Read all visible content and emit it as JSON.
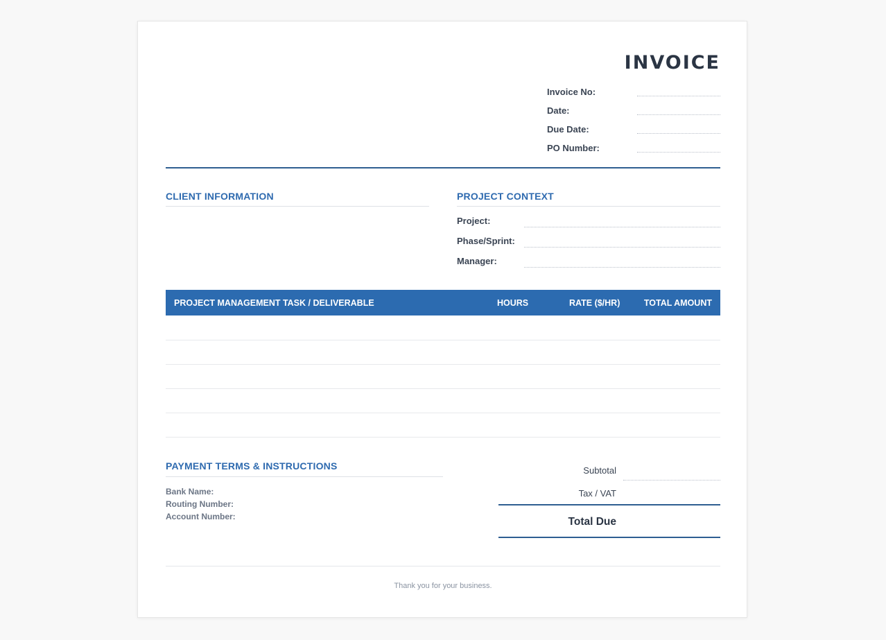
{
  "invoice": {
    "title": "INVOICE",
    "meta": [
      {
        "label": "Invoice No:",
        "value": ""
      },
      {
        "label": "Date:",
        "value": ""
      },
      {
        "label": "Due Date:",
        "value": ""
      },
      {
        "label": "PO Number:",
        "value": ""
      }
    ]
  },
  "client": {
    "heading": "CLIENT INFORMATION"
  },
  "project": {
    "heading": "PROJECT CONTEXT",
    "fields": [
      {
        "label": "Project:",
        "value": ""
      },
      {
        "label": "Phase/Sprint:",
        "value": ""
      },
      {
        "label": "Manager:",
        "value": ""
      }
    ]
  },
  "table": {
    "headers": [
      "PROJECT MANAGEMENT TASK / DELIVERABLE",
      "HOURS",
      "RATE ($/HR)",
      "TOTAL AMOUNT"
    ],
    "rows": [
      [
        "",
        "",
        "",
        ""
      ],
      [
        "",
        "",
        "",
        ""
      ],
      [
        "",
        "",
        "",
        ""
      ],
      [
        "",
        "",
        "",
        ""
      ],
      [
        "",
        "",
        "",
        ""
      ]
    ]
  },
  "payment": {
    "heading": "PAYMENT TERMS & INSTRUCTIONS",
    "fields": [
      "Bank Name:",
      "Routing Number:",
      "Account Number:"
    ]
  },
  "totals": {
    "subtotal_label": "Subtotal",
    "tax_label": "Tax / VAT",
    "total_due_label": "Total Due"
  },
  "footer": {
    "thanks": "Thank you for your business."
  },
  "colors": {
    "accent": "#2c6bb0",
    "rule": "#2e5e91",
    "heading_text": "#2e6aaf",
    "body_text": "#3a4453",
    "background": "#f8f8f8"
  }
}
